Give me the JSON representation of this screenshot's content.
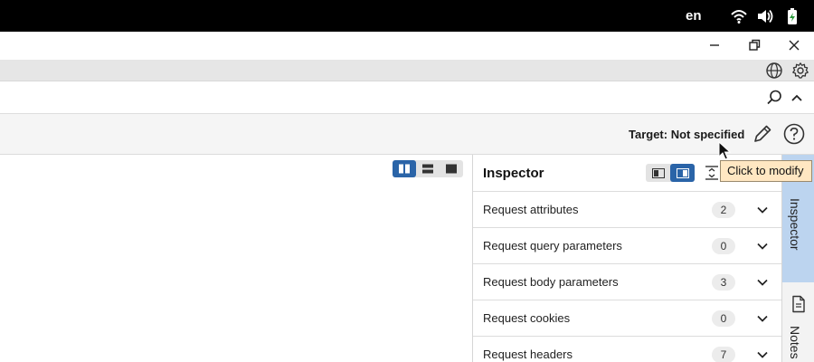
{
  "system": {
    "language": "en",
    "icons": [
      "wifi-icon",
      "volume-icon",
      "battery-icon"
    ]
  },
  "window": {
    "controls": [
      "minimize",
      "restore",
      "close"
    ]
  },
  "toolbar": {
    "icons": [
      "globe-icon",
      "gear-icon"
    ]
  },
  "search_strip": {
    "icons": [
      "search-icon",
      "chevron-up-icon"
    ]
  },
  "target": {
    "label": "Target: Not specified",
    "edit_icon": "pencil-icon",
    "help_icon": "help-icon"
  },
  "tooltip": {
    "text": "Click to modify"
  },
  "inspector": {
    "title": "Inspector",
    "rows": [
      {
        "label": "Request attributes",
        "count": "2"
      },
      {
        "label": "Request query parameters",
        "count": "0"
      },
      {
        "label": "Request body parameters",
        "count": "3"
      },
      {
        "label": "Request cookies",
        "count": "0"
      },
      {
        "label": "Request headers",
        "count": "7"
      }
    ]
  },
  "side_rail": {
    "tabs": [
      {
        "label": "Inspector",
        "active": true
      },
      {
        "label": "Notes",
        "active": false
      }
    ]
  },
  "colors": {
    "accent": "#2a64a8",
    "tooltip_bg": "#ffe7c2",
    "rail_active": "#bcd4ef"
  }
}
